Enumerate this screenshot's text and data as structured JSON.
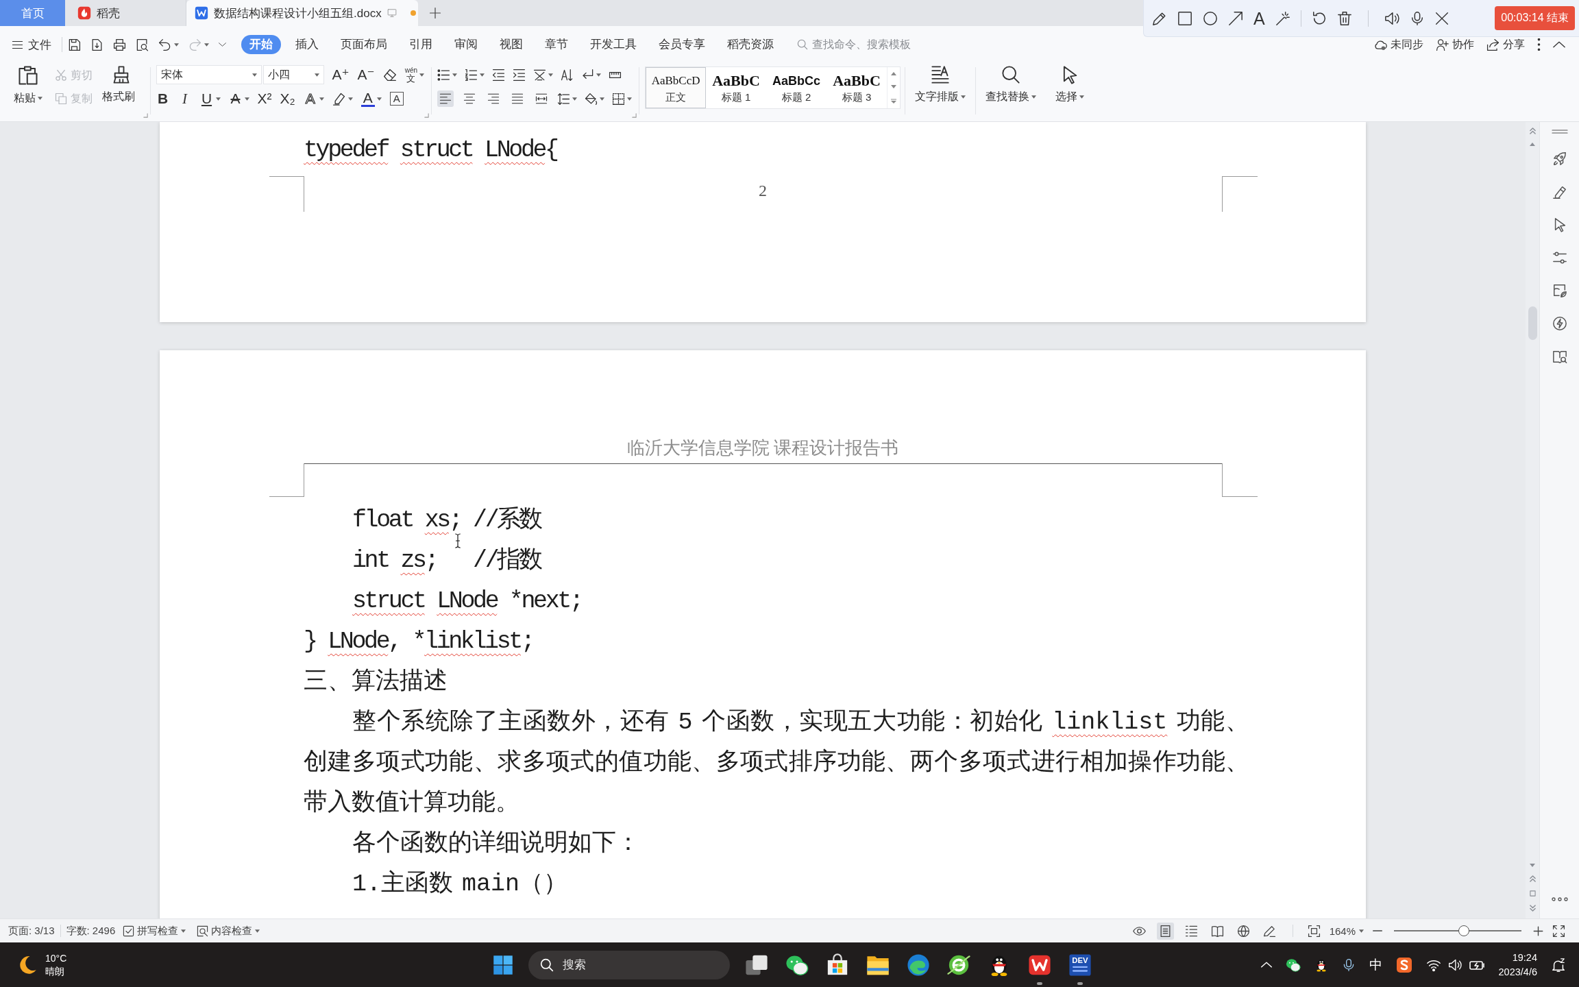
{
  "tab_bar": {
    "tabs": [
      {
        "kind": "home",
        "label": "首页",
        "selected": false
      },
      {
        "kind": "app",
        "label": "稻壳",
        "selected": false
      },
      {
        "kind": "document",
        "label": "数据结构课程设计小组五组.docx",
        "selected": true,
        "unsaved": true
      }
    ]
  },
  "recording_bar": {
    "text_tool": "A",
    "stop_button": "00:03:14 结束"
  },
  "menu_bar": {
    "file_menu": "文件",
    "quick_access": [
      {
        "kind": "save",
        "disabled": false
      },
      {
        "kind": "export",
        "disabled": false
      },
      {
        "kind": "print",
        "disabled": false
      },
      {
        "kind": "preview",
        "disabled": false
      },
      {
        "kind": "undo",
        "disabled": false
      },
      {
        "kind": "redo",
        "disabled": true
      }
    ],
    "tabs": [
      {
        "label": "开始",
        "selected": true
      },
      {
        "label": "插入",
        "selected": false
      },
      {
        "label": "页面布局",
        "selected": false
      },
      {
        "label": "引用",
        "selected": false
      },
      {
        "label": "审阅",
        "selected": false
      },
      {
        "label": "视图",
        "selected": false
      },
      {
        "label": "章节",
        "selected": false
      },
      {
        "label": "开发工具",
        "selected": false
      },
      {
        "label": "会员专享",
        "selected": false
      },
      {
        "label": "稻壳资源",
        "selected": false
      }
    ],
    "search": {
      "placeholder": "查找命令、搜索模板"
    },
    "actions": [
      {
        "kind": "sync",
        "label": "未同步"
      },
      {
        "kind": "collaborate",
        "label": "协作"
      },
      {
        "kind": "share",
        "label": "分享"
      }
    ]
  },
  "ribbon": {
    "clipboard": {
      "paste": "粘贴",
      "cut": {
        "label": "剪切",
        "disabled": true
      },
      "copy": {
        "label": "复制",
        "disabled": true
      },
      "format_painter": "格式刷"
    },
    "font": {
      "name": "宋体",
      "size": "小四",
      "tools": [
        {
          "kind": "grow",
          "glyph": "A⁺"
        },
        {
          "kind": "shrink",
          "glyph": "A⁻"
        },
        {
          "kind": "clear"
        },
        {
          "kind": "pinyin",
          "glyph": "wén",
          "base": "文"
        }
      ],
      "formats": [
        {
          "kind": "bold",
          "glyph": "B"
        },
        {
          "kind": "italic",
          "glyph": "I"
        },
        {
          "kind": "underline",
          "glyph": "U"
        },
        {
          "kind": "strikethrough",
          "glyph": "A"
        },
        {
          "kind": "superscript",
          "glyph": "X²"
        },
        {
          "kind": "subscript",
          "glyph": "X₂"
        },
        {
          "kind": "outline",
          "glyph": "A"
        },
        {
          "kind": "highlight"
        },
        {
          "kind": "font-color",
          "glyph": "A"
        },
        {
          "kind": "char-border",
          "glyph": "A"
        }
      ]
    },
    "paragraph": {
      "alignment": [
        {
          "kind": "left",
          "selected": true
        },
        {
          "kind": "center",
          "selected": false
        },
        {
          "kind": "right",
          "selected": false
        },
        {
          "kind": "justify",
          "selected": false
        },
        {
          "kind": "distributed",
          "selected": false
        }
      ]
    },
    "styles": [
      {
        "kind": "body",
        "preview": "AaBbCcD",
        "label": "正文",
        "selected": true
      },
      {
        "kind": "heading1",
        "preview": "AaBbC",
        "label": "标题 1",
        "selected": false
      },
      {
        "kind": "heading2",
        "preview": "AaBbCc",
        "label": "标题 2",
        "selected": false
      },
      {
        "kind": "heading3",
        "preview": "AaBbC",
        "label": "标题 3",
        "selected": false
      }
    ],
    "buttons": [
      {
        "kind": "text-layout",
        "label": "文字排版"
      },
      {
        "kind": "find-replace",
        "label": "查找替换"
      },
      {
        "kind": "select",
        "label": "选择"
      }
    ]
  },
  "document": {
    "page_above": {
      "code_lines": [
        {
          "kind": "code",
          "indent": false,
          "segments": [
            {
              "text": "typedef ",
              "flagged": true
            },
            {
              "text": "struct ",
              "flagged": true
            },
            {
              "text": "LNode",
              "flagged": true
            },
            {
              "text": "{",
              "flagged": false
            }
          ]
        }
      ],
      "page_number": "2"
    },
    "current_page": {
      "header": "临沂大学信息学院 课程设计报告书",
      "blocks": [
        {
          "kind": "code",
          "indent": true,
          "segments": [
            {
              "text": "float ",
              "flagged": false
            },
            {
              "text": "xs",
              "flagged": true
            },
            {
              "text": "; //系数",
              "flagged": false
            }
          ]
        },
        {
          "kind": "code",
          "indent": true,
          "segments": [
            {
              "text": "int ",
              "flagged": false
            },
            {
              "text": "zs",
              "flagged": true
            },
            {
              "text": ";   //指数",
              "flagged": false
            }
          ]
        },
        {
          "kind": "code",
          "indent": true,
          "segments": [
            {
              "text": "struct ",
              "flagged": true
            },
            {
              "text": "LNode",
              "flagged": true
            },
            {
              "text": " *next;",
              "flagged": false
            }
          ]
        },
        {
          "kind": "code",
          "indent": false,
          "segments": [
            {
              "text": "} ",
              "flagged": false
            },
            {
              "text": "LNode",
              "flagged": true
            },
            {
              "text": ", *",
              "flagged": false
            },
            {
              "text": "linklist",
              "flagged": true
            },
            {
              "text": ";",
              "flagged": false
            }
          ]
        },
        {
          "kind": "text",
          "indent": false,
          "segments": [
            {
              "text": "三、算法描述",
              "flagged": false
            }
          ]
        },
        {
          "kind": "text",
          "indent": true,
          "segments": [
            {
              "text": "整个系统除了主函数外，还有 5 个函数，实现五大功能：初始化 ",
              "flagged": false
            },
            {
              "text": "linklist",
              "flagged": true
            },
            {
              "text": " 功能、创建多项式功能、求多项式的值功能、多项式排序功能、两个多项式进行相加操作功能、带入数值计算功能。",
              "flagged": false
            }
          ]
        },
        {
          "kind": "text",
          "indent": true,
          "segments": [
            {
              "text": "各个函数的详细说明如下：",
              "flagged": false
            }
          ]
        },
        {
          "kind": "text",
          "indent": true,
          "segments": [
            {
              "text": "1.主函数 main（）",
              "flagged": false
            }
          ]
        }
      ]
    }
  },
  "status_bar": {
    "page": "页面: 3/13",
    "word_count": "字数: 2496",
    "spell_check": "拼写检查",
    "content_check": "内容检查",
    "views": [
      {
        "kind": "reading",
        "selected": false
      },
      {
        "kind": "page",
        "selected": true
      },
      {
        "kind": "outline",
        "selected": false
      },
      {
        "kind": "book",
        "selected": false
      },
      {
        "kind": "web",
        "selected": false
      },
      {
        "kind": "write",
        "selected": false
      }
    ],
    "zoom": {
      "value": "164%",
      "level": 0.55
    }
  },
  "taskbar": {
    "weather": {
      "temperature": "10°C",
      "condition": "晴朗"
    },
    "search": {
      "placeholder": "搜索"
    },
    "apps": [
      {
        "kind": "task-view",
        "running": false
      },
      {
        "kind": "chat",
        "running": false
      },
      {
        "kind": "store",
        "running": false
      },
      {
        "kind": "files",
        "running": false
      },
      {
        "kind": "edge",
        "running": false
      },
      {
        "kind": "browser",
        "running": false
      },
      {
        "kind": "penguin",
        "running": false
      },
      {
        "kind": "office",
        "running": true
      },
      {
        "kind": "ide",
        "running": true,
        "logo_text": "DEV"
      }
    ],
    "tray": {
      "input_method": "中"
    },
    "clock": {
      "time": "19:24",
      "date": "2023/4/6"
    }
  }
}
